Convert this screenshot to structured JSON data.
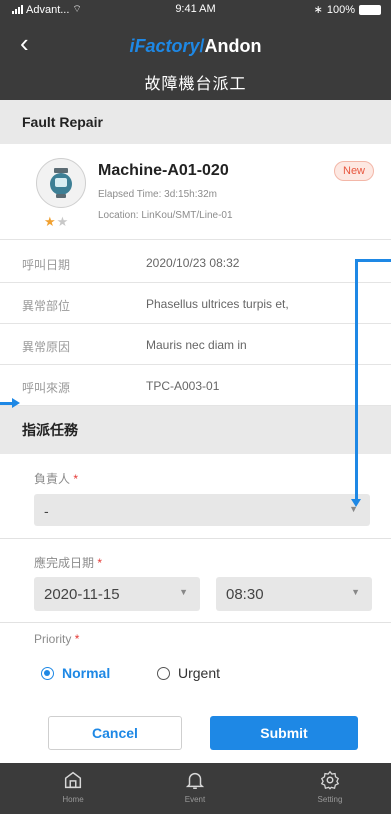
{
  "status_bar": {
    "carrier": "Advant...",
    "time": "9:41 AM",
    "battery": "100%"
  },
  "header": {
    "brand": "iFactory",
    "slash": "/",
    "app": "Andon",
    "page_title": "故障機台派工"
  },
  "fault_section": {
    "title": "Fault Repair"
  },
  "machine": {
    "name": "Machine-A01-020",
    "elapsed": "Elapsed Time: 3d:15h:32m",
    "location": "Location: LinKou/SMT/Line-01",
    "badge": "New",
    "rating": 1,
    "rating_max": 2
  },
  "info_rows": [
    {
      "label": "呼叫日期",
      "value": "2020/10/23 08:32"
    },
    {
      "label": "異常部位",
      "value": "Phasellus ultrices turpis et,"
    },
    {
      "label": "異常原因",
      "value": "Mauris nec diam in"
    },
    {
      "label": "呼叫來源",
      "value": "TPC-A003-01"
    }
  ],
  "assign_section": {
    "title": "指派任務"
  },
  "form": {
    "assignee_label": "負責人",
    "assignee_value": "-",
    "due_label": "應完成日期",
    "due_date": "2020-11-15",
    "due_time": "08:30",
    "priority_label": "Priority",
    "required_mark": "*",
    "priority_options": [
      {
        "label": "Normal",
        "selected": true
      },
      {
        "label": "Urgent",
        "selected": false
      }
    ]
  },
  "actions": {
    "cancel": "Cancel",
    "submit": "Submit"
  },
  "tabbar": [
    {
      "label": "Home",
      "icon": "home-icon"
    },
    {
      "label": "Event",
      "icon": "bell-icon"
    },
    {
      "label": "Setting",
      "icon": "gear-icon"
    }
  ],
  "colors": {
    "accent": "#1e88e5",
    "header_bg": "#3b3b3b",
    "badge_new": "#e8563e"
  }
}
